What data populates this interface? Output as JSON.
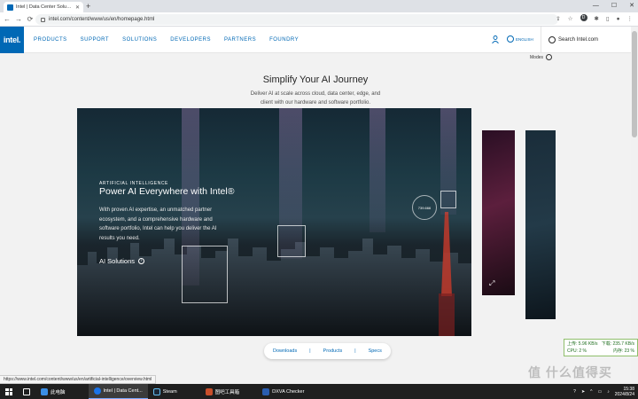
{
  "browser": {
    "tab_title": "Intel | Data Center Solutions, I...",
    "tab_close": "✕",
    "new_tab": "+",
    "back": "←",
    "forward": "→",
    "reload": "⟳",
    "url": "intel.com/content/www/us/en/homepage.html",
    "window_controls": [
      "—",
      "☐",
      "✕"
    ],
    "status_url": "https://www.intel.com/content/www/us/en/artificial-intelligence/overview.html"
  },
  "header": {
    "logo": "intel.",
    "nav": [
      "PRODUCTS",
      "SUPPORT",
      "SOLUTIONS",
      "DEVELOPERS",
      "PARTNERS",
      "FOUNDRY"
    ],
    "language": "ENGLISH",
    "search_placeholder": "Search Intel.com"
  },
  "modes_label": "Modes",
  "hero": {
    "title": "Simplify Your AI Journey",
    "subtitle": "Deliver AI at scale across cloud, data center, edge, and client with our hardware and software portfolio."
  },
  "card": {
    "label": "ARTIFICIAL INTELLIGENCE",
    "title": "Power AI Everywhere with Intel®",
    "description": "With proven AI expertise, an unmatched partner ecosystem, and a comprehensive hardware and software portfolio, Intel can help you deliver the AI results you need.",
    "cta": "AI Solutions",
    "gauge_value": "739.666"
  },
  "pills": [
    "Downloads",
    "Products",
    "Specs"
  ],
  "net_monitor": {
    "up_label": "上传:",
    "up_value": "5.96 KB/s",
    "down_label": "下载:",
    "down_value": "235.7 KB/s",
    "cpu_label": "CPU:",
    "cpu_value": "2 %",
    "mem_label": "内存:",
    "mem_value": "23 %"
  },
  "watermark": "值 什么值得买",
  "taskbar": {
    "items": [
      {
        "label": "此电脑",
        "color": "#3a8ee6"
      },
      {
        "label": "Intel | Data Cent...",
        "color": "#1a73e8",
        "active": true
      },
      {
        "label": "Steam",
        "color": "#1b2838"
      },
      {
        "label": "图吧工具箱",
        "color": "#c94f2b"
      },
      {
        "label": "DXVA Checker",
        "color": "#2a5db0"
      }
    ],
    "time": "15:38",
    "date": "2024/8/24"
  },
  "colors": {
    "intel_blue": "#0068b5",
    "taskbar": "#1f1f1f"
  }
}
